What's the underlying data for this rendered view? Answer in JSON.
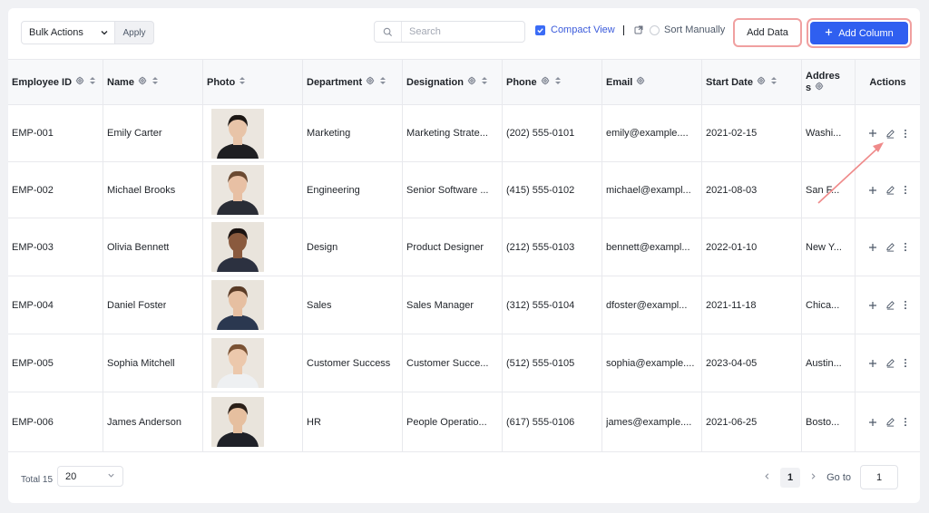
{
  "toolbar": {
    "bulk_actions": "Bulk Actions",
    "apply": "Apply",
    "search_placeholder": "Search",
    "compact_view": "Compact View",
    "sort_manually": "Sort Manually",
    "add_data": "Add Data",
    "add_column": "Add Column"
  },
  "table": {
    "headers": {
      "employee_id": "Employee ID",
      "name": "Name",
      "photo": "Photo",
      "department": "Department",
      "designation": "Designation",
      "phone": "Phone",
      "email": "Email",
      "start_date": "Start Date",
      "address_1": "Addres",
      "address_2": "s",
      "actions": "Actions"
    },
    "rows": [
      {
        "id": "EMP-001",
        "name": "Emily Carter",
        "department": "Marketing",
        "designation": "Marketing Strate...",
        "phone": "(202) 555-0101",
        "email": "emily@example....",
        "start_date": "2021-02-15",
        "address": "Washi..."
      },
      {
        "id": "EMP-002",
        "name": "Michael Brooks",
        "department": "Engineering",
        "designation": "Senior Software ...",
        "phone": "(415) 555-0102",
        "email": "michael@exampl...",
        "start_date": "2021-08-03",
        "address": "San F..."
      },
      {
        "id": "EMP-003",
        "name": "Olivia Bennett",
        "department": "Design",
        "designation": "Product Designer",
        "phone": "(212) 555-0103",
        "email": "bennett@exampl...",
        "start_date": "2022-01-10",
        "address": "New Y..."
      },
      {
        "id": "EMP-004",
        "name": "Daniel Foster",
        "department": "Sales",
        "designation": "Sales Manager",
        "phone": "(312) 555-0104",
        "email": "dfoster@exampl...",
        "start_date": "2021-11-18",
        "address": "Chica..."
      },
      {
        "id": "EMP-005",
        "name": "Sophia Mitchell",
        "department": "Customer Success",
        "designation": "Customer Succe...",
        "phone": "(512) 555-0105",
        "email": "sophia@example....",
        "start_date": "2023-04-05",
        "address": "Austin..."
      },
      {
        "id": "EMP-006",
        "name": "James Anderson",
        "department": "HR",
        "designation": "People Operatio...",
        "phone": "(617) 555-0106",
        "email": "james@example....",
        "start_date": "2021-06-25",
        "address": "Bosto..."
      }
    ]
  },
  "footer": {
    "total": "Total 15",
    "page_size": "20",
    "current_page": "1",
    "goto_label": "Go to",
    "goto_value": "1"
  },
  "icons": {
    "search": "search-icon",
    "sort": "sort-icon",
    "settings": "gear-icon",
    "add": "plus-icon",
    "edit": "pencil-icon",
    "more": "more-vertical-icon"
  },
  "colors": {
    "primary": "#2f5ff0",
    "highlight": "#f0a0a0",
    "arrow": "#ef8a8a"
  }
}
